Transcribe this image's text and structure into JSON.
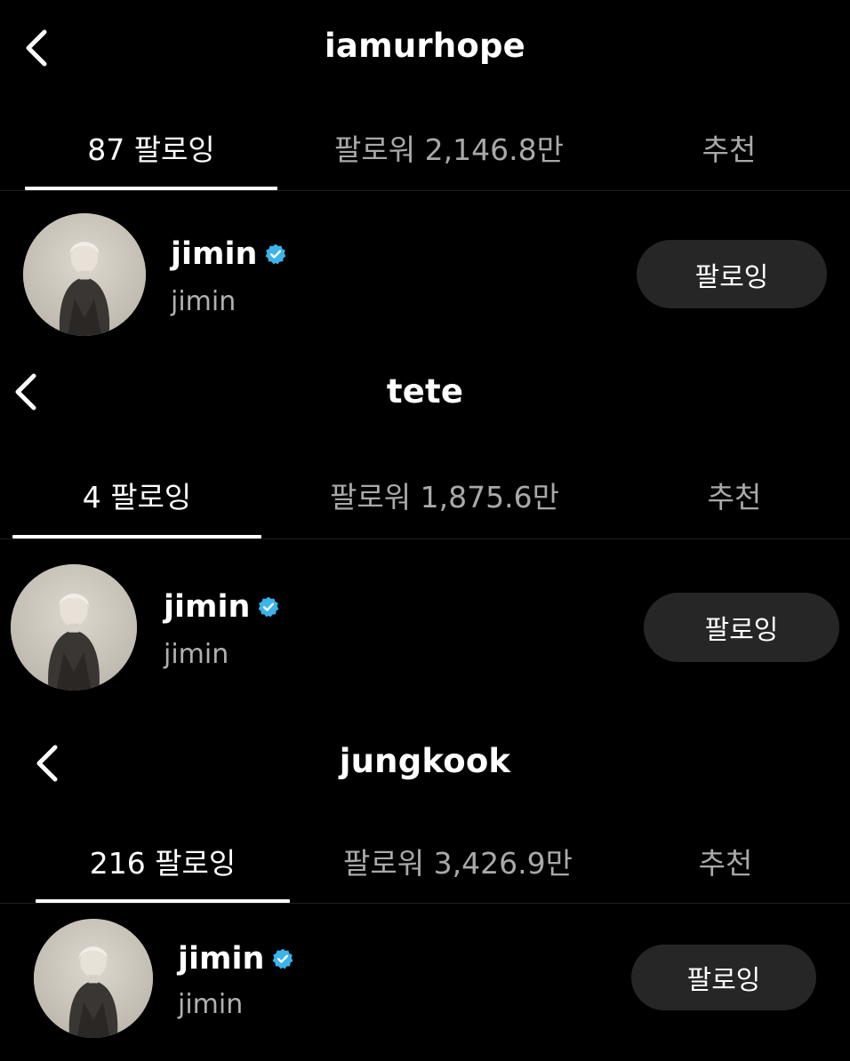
{
  "colors": {
    "background": "#000000",
    "verified_badge": "#3bb3ec",
    "follow_button_bg": "#262626"
  },
  "panels": [
    {
      "back_icon": "chevron-left-icon",
      "title": "iamurhope",
      "tabs": [
        {
          "label": "87 팔로잉",
          "active": true
        },
        {
          "label": "팔로워 2,146.8만",
          "active": false
        },
        {
          "label": "추천",
          "active": false
        }
      ],
      "user": {
        "username": "jimin",
        "display_name": "jimin",
        "verified_icon": "verified-badge-icon",
        "button_label": "팔로잉"
      }
    },
    {
      "back_icon": "chevron-left-icon",
      "title": "tete",
      "tabs": [
        {
          "label": "4 팔로잉",
          "active": true
        },
        {
          "label": "팔로워 1,875.6만",
          "active": false
        },
        {
          "label": "추천",
          "active": false
        }
      ],
      "user": {
        "username": "jimin",
        "display_name": "jimin",
        "verified_icon": "verified-badge-icon",
        "button_label": "팔로잉"
      }
    },
    {
      "back_icon": "chevron-left-icon",
      "title": "jungkook",
      "tabs": [
        {
          "label": "216 팔로잉",
          "active": true
        },
        {
          "label": "팔로워 3,426.9만",
          "active": false
        },
        {
          "label": "추천",
          "active": false
        }
      ],
      "user": {
        "username": "jimin",
        "display_name": "jimin",
        "verified_icon": "verified-badge-icon",
        "button_label": "팔로잉"
      }
    }
  ]
}
